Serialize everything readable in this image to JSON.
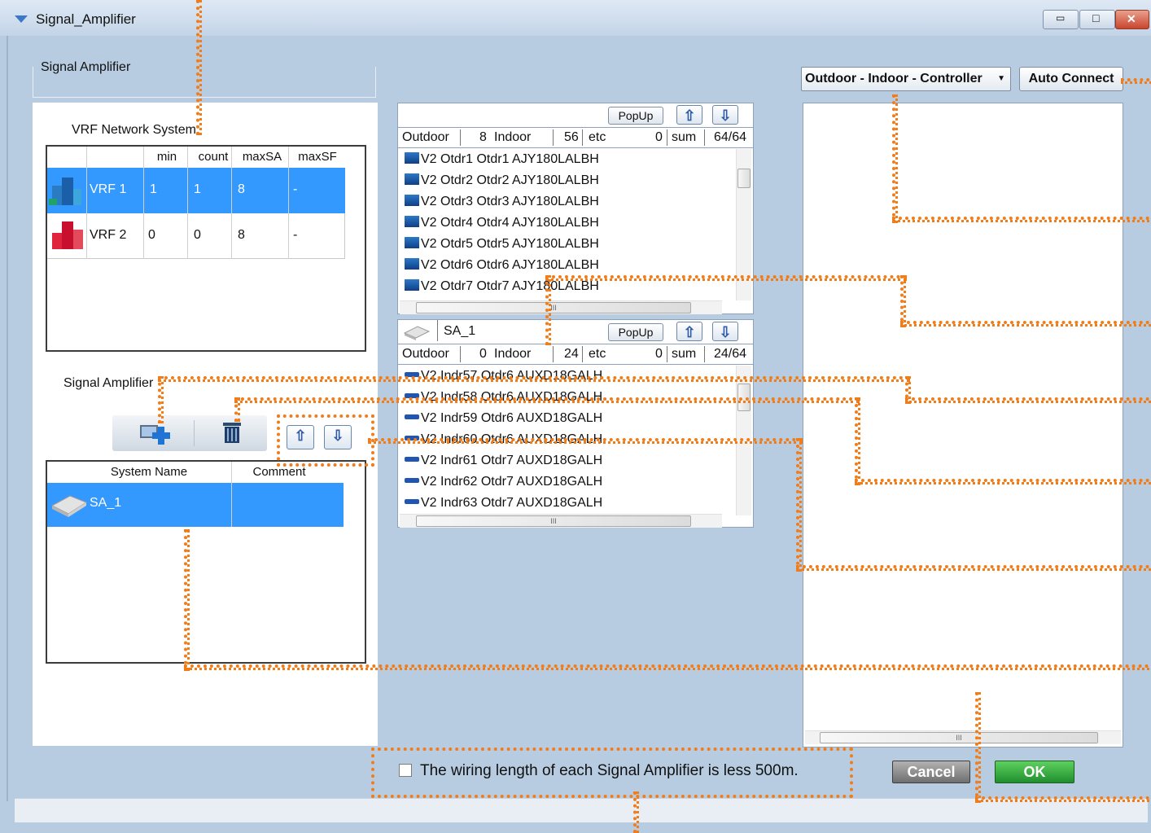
{
  "window": {
    "title": "Signal_Amplifier",
    "controls": {
      "minimize": "▭",
      "maximize": "□",
      "close": "✕"
    }
  },
  "left": {
    "group_title": "Signal Amplifier",
    "vrf": {
      "label": "VRF Network System",
      "columns": [
        "min",
        "count",
        "maxSA",
        "maxSF"
      ],
      "rows": [
        {
          "name": "VRF 1",
          "min": "1",
          "count": "1",
          "maxSA": "8",
          "maxSF": "-",
          "selected": true
        },
        {
          "name": "VRF 2",
          "min": "0",
          "count": "0",
          "maxSA": "8",
          "maxSF": "-",
          "selected": false
        }
      ]
    },
    "sa": {
      "label": "Signal Amplifier",
      "columns": [
        "System Name",
        "Comment"
      ],
      "rows": [
        {
          "name": "SA_1",
          "comment": "",
          "selected": true
        }
      ]
    }
  },
  "middle": {
    "top": {
      "popup": "PopUp",
      "stats": {
        "outdoor_label": "Outdoor",
        "outdoor": "8",
        "indoor_label": "Indoor",
        "indoor": "56",
        "etc_label": "etc",
        "etc": "0",
        "sum_label": "sum",
        "sum": "64/64"
      },
      "items": [
        "V2  Otdr1  Otdr1  AJY180LALBH",
        "V2  Otdr2  Otdr2  AJY180LALBH",
        "V2  Otdr3  Otdr3  AJY180LALBH",
        "V2  Otdr4  Otdr4  AJY180LALBH",
        "V2  Otdr5  Otdr5  AJY180LALBH",
        "V2  Otdr6  Otdr6  AJY180LALBH",
        "V2  Otdr7  Otdr7  AJY180LALBH"
      ],
      "hscroll_grip": "III"
    },
    "bottom": {
      "name": "SA_1",
      "popup": "PopUp",
      "stats": {
        "outdoor_label": "Outdoor",
        "outdoor": "0",
        "indoor_label": "Indoor",
        "indoor": "24",
        "etc_label": "etc",
        "etc": "0",
        "sum_label": "sum",
        "sum": "24/64"
      },
      "items": [
        "V2  Indr57  Otdr6  AUXD18GALH",
        "V2  Indr58  Otdr6  AUXD18GALH",
        "V2  Indr59  Otdr6  AUXD18GALH",
        "V2  Indr60  Otdr6  AUXD18GALH",
        "V2  Indr61  Otdr7  AUXD18GALH",
        "V2  Indr62  Otdr7  AUXD18GALH",
        "V2  Indr63  Otdr7  AUXD18GALH"
      ],
      "hscroll_grip": "III"
    }
  },
  "right": {
    "dropdown": "Outdoor - Indoor - Controller",
    "auto_connect": "Auto Connect",
    "hscroll_grip": "III"
  },
  "bottom": {
    "checkbox_label": "The wiring length of each Signal Amplifier is less 500m.",
    "cancel": "Cancel",
    "ok": "OK"
  },
  "icons": {
    "vrf1": "building-blue-icon",
    "vrf2": "building-red-icon",
    "add": "add-amplifier-icon",
    "delete": "trash-icon",
    "up": "up-arrow-icon",
    "down": "down-arrow-icon",
    "sa": "signal-amplifier-device-icon"
  },
  "colors": {
    "selection": "#3399ff",
    "annotation": "#f07d1a",
    "ok": "#22a43a",
    "cancel": "#7c7c7c"
  }
}
